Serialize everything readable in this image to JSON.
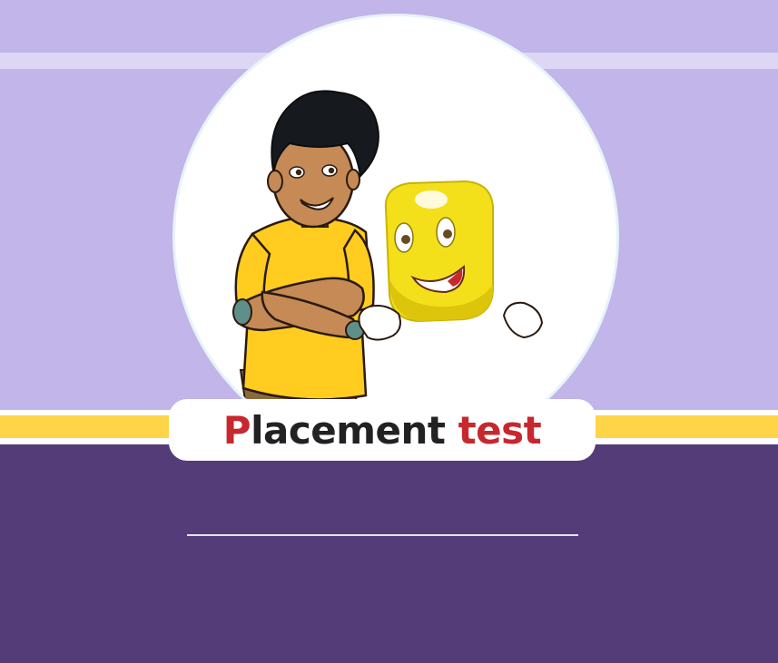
{
  "title": {
    "first_letter": "P",
    "middle": "lacement ",
    "last_word": "test"
  },
  "colors": {
    "background_lavender": "#c1b5e9",
    "panel_purple": "#533c78",
    "band_yellow": "#ffd447",
    "title_red": "#c6282e",
    "title_dark": "#222222"
  },
  "illustration": {
    "characters": [
      "boy-character",
      "yellow-mascot-character"
    ]
  }
}
